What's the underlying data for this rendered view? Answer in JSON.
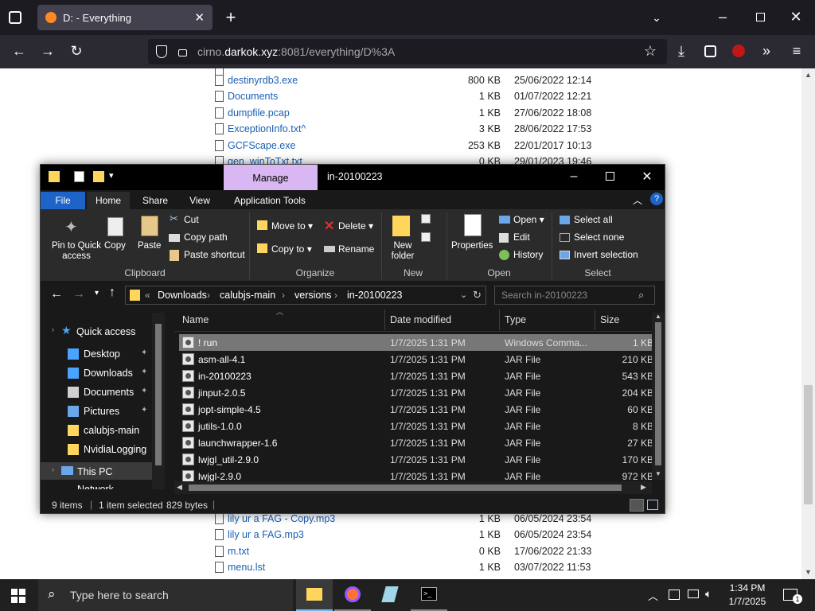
{
  "browser": {
    "tab_title": "D: - Everything",
    "url_prefix": "cirno.",
    "url_host": "darkok.xyz",
    "url_rest": ":8081/everything/D%3A"
  },
  "page_rows_top": [
    {
      "name": "destinyrdb3.exe",
      "size": "800 KB",
      "date": "25/06/2022 12:14"
    },
    {
      "name": "Documents",
      "size": "1 KB",
      "date": "01/07/2022 12:21"
    },
    {
      "name": "dumpfile.pcap",
      "size": "1 KB",
      "date": "27/06/2022 18:08"
    },
    {
      "name": "ExceptionInfo.txt^",
      "size": "3 KB",
      "date": "28/06/2022 17:53"
    },
    {
      "name": "GCFScape.exe",
      "size": "253 KB",
      "date": "22/01/2017 10:13"
    },
    {
      "name": "gen_winToTxt.txt",
      "size": "0 KB",
      "date": "29/01/2023 19:46"
    }
  ],
  "page_rows_bottom": [
    {
      "name": "lily ur a FAG - Copy.mp3",
      "size": "1 KB",
      "date": "06/05/2024 23:54"
    },
    {
      "name": "lily ur a FAG.mp3",
      "size": "1 KB",
      "date": "06/05/2024 23:54"
    },
    {
      "name": "m.txt",
      "size": "0 KB",
      "date": "17/06/2022 21:33"
    },
    {
      "name": "menu.lst",
      "size": "1 KB",
      "date": "03/07/2022 11:53"
    }
  ],
  "explorer": {
    "manage_tab": "Manage",
    "window_title": "in-20100223",
    "tabs": {
      "file": "File",
      "home": "Home",
      "share": "Share",
      "view": "View",
      "apptools": "Application Tools"
    },
    "ribbon": {
      "pin": "Pin to Quick access",
      "copy": "Copy",
      "paste": "Paste",
      "cut": "Cut",
      "copy_path": "Copy path",
      "paste_shortcut": "Paste shortcut",
      "move_to": "Move to",
      "copy_to": "Copy to",
      "delete": "Delete",
      "rename": "Rename",
      "new_folder": "New folder",
      "properties": "Properties",
      "open": "Open",
      "edit": "Edit",
      "history": "History",
      "select_all": "Select all",
      "select_none": "Select none",
      "invert_selection": "Invert selection",
      "groups": {
        "clipboard": "Clipboard",
        "organize": "Organize",
        "new": "New",
        "open": "Open",
        "select": "Select"
      }
    },
    "breadcrumb": [
      "Downloads",
      "calubjs-main",
      "versions",
      "in-20100223"
    ],
    "search_placeholder": "Search in-20100223",
    "nav": {
      "quick_access": "Quick access",
      "items": [
        "Desktop",
        "Downloads",
        "Documents",
        "Pictures",
        "calubjs-main",
        "NvidiaLogging"
      ],
      "this_pc": "This PC",
      "network": "Network"
    },
    "columns": {
      "name": "Name",
      "date": "Date modified",
      "type": "Type",
      "size": "Size"
    },
    "files": [
      {
        "name": "! run",
        "date": "1/7/2025 1:31 PM",
        "type": "Windows Comma...",
        "size": "1 KB"
      },
      {
        "name": "asm-all-4.1",
        "date": "1/7/2025 1:31 PM",
        "type": "JAR File",
        "size": "210 KB"
      },
      {
        "name": "in-20100223",
        "date": "1/7/2025 1:31 PM",
        "type": "JAR File",
        "size": "543 KB"
      },
      {
        "name": "jinput-2.0.5",
        "date": "1/7/2025 1:31 PM",
        "type": "JAR File",
        "size": "204 KB"
      },
      {
        "name": "jopt-simple-4.5",
        "date": "1/7/2025 1:31 PM",
        "type": "JAR File",
        "size": "60 KB"
      },
      {
        "name": "jutils-1.0.0",
        "date": "1/7/2025 1:31 PM",
        "type": "JAR File",
        "size": "8 KB"
      },
      {
        "name": "launchwrapper-1.6",
        "date": "1/7/2025 1:31 PM",
        "type": "JAR File",
        "size": "27 KB"
      },
      {
        "name": "lwjgl_util-2.9.0",
        "date": "1/7/2025 1:31 PM",
        "type": "JAR File",
        "size": "170 KB"
      },
      {
        "name": "lwjgl-2.9.0",
        "date": "1/7/2025 1:31 PM",
        "type": "JAR File",
        "size": "972 KB"
      }
    ],
    "status": {
      "items": "9 items",
      "selected": "1 item selected",
      "bytes": "829 bytes"
    }
  },
  "taskbar": {
    "search": "Type here to search",
    "time": "1:34 PM",
    "date": "1/7/2025",
    "notif_count": "1"
  }
}
